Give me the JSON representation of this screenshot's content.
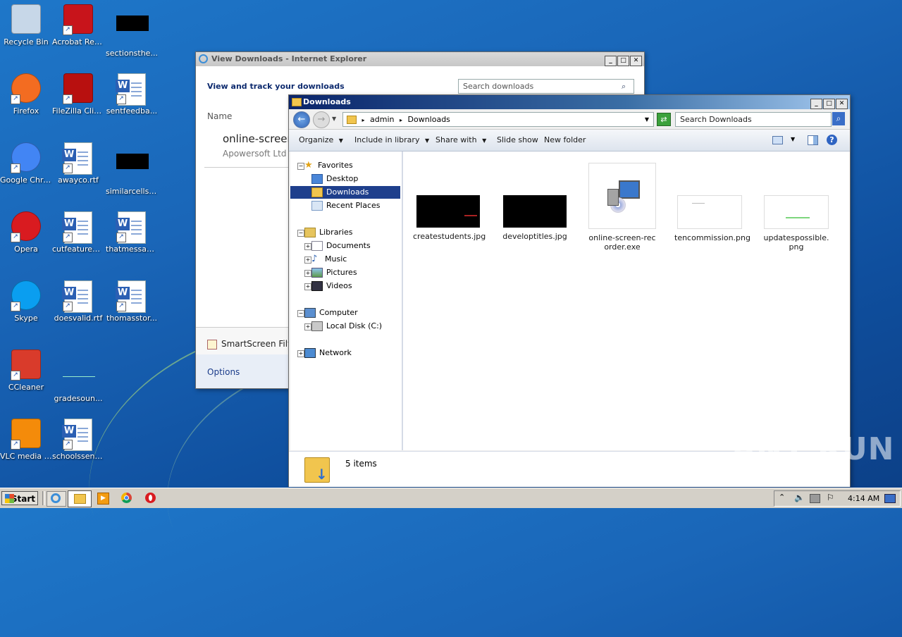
{
  "desktop": {
    "icons": [
      {
        "label": "Recycle Bin",
        "icon": "recycle-bin-icon"
      },
      {
        "label": "Acrobat Reader DC",
        "icon": "acrobat-icon"
      },
      {
        "label": "sectionsthe...",
        "icon": "image-file-icon"
      },
      {
        "label": "Firefox",
        "icon": "firefox-icon"
      },
      {
        "label": "FileZilla Client",
        "icon": "filezilla-icon"
      },
      {
        "label": "sentfeedba...",
        "icon": "word-doc-icon"
      },
      {
        "label": "Google Chrome",
        "icon": "chrome-icon"
      },
      {
        "label": "awayco.rtf",
        "icon": "word-doc-icon"
      },
      {
        "label": "similarcells.jpg",
        "icon": "image-file-icon"
      },
      {
        "label": "Opera",
        "icon": "opera-icon"
      },
      {
        "label": "cutfeatured...",
        "icon": "word-doc-icon"
      },
      {
        "label": "thatmessag...",
        "icon": "word-doc-icon"
      },
      {
        "label": "Skype",
        "icon": "skype-icon"
      },
      {
        "label": "doesvalid.rtf",
        "icon": "word-doc-icon"
      },
      {
        "label": "thomasstor...",
        "icon": "word-doc-icon"
      },
      {
        "label": "CCleaner",
        "icon": "ccleaner-icon"
      },
      {
        "label": "gradesoun...",
        "icon": "image-file-icon"
      },
      {
        "label": "VLC media player",
        "icon": "vlc-icon"
      },
      {
        "label": "schoolssent...",
        "icon": "word-doc-icon"
      }
    ]
  },
  "ie_window": {
    "title": "View Downloads - Internet Explorer",
    "heading": "View and track your downloads",
    "search_placeholder": "Search downloads",
    "column_name": "Name",
    "item_name": "online-screen",
    "item_publisher": "Apowersoft Ltd",
    "smartscreen": "SmartScreen Filte",
    "options": "Options"
  },
  "explorer": {
    "title": "Downloads",
    "breadcrumb": [
      "admin",
      "Downloads"
    ],
    "search_placeholder": "Search Downloads",
    "commands": [
      "Organize",
      "Include in library",
      "Share with",
      "Slide show",
      "New folder"
    ],
    "tree": {
      "favorites": "Favorites",
      "desktop": "Desktop",
      "downloads": "Downloads",
      "recent": "Recent Places",
      "libraries": "Libraries",
      "documents": "Documents",
      "music": "Music",
      "pictures": "Pictures",
      "videos": "Videos",
      "computer": "Computer",
      "localdisk": "Local Disk (C:)",
      "network": "Network"
    },
    "files": [
      {
        "name": "createstudents.jpg"
      },
      {
        "name": "developtitles.jpg"
      },
      {
        "name": "online-screen-recorder.exe"
      },
      {
        "name": "tencommission.png"
      },
      {
        "name": "updatespossible.png"
      }
    ],
    "status": "5 items"
  },
  "taskbar": {
    "start": "Start",
    "clock": "4:14 AM"
  },
  "watermark": "ANY RUN"
}
